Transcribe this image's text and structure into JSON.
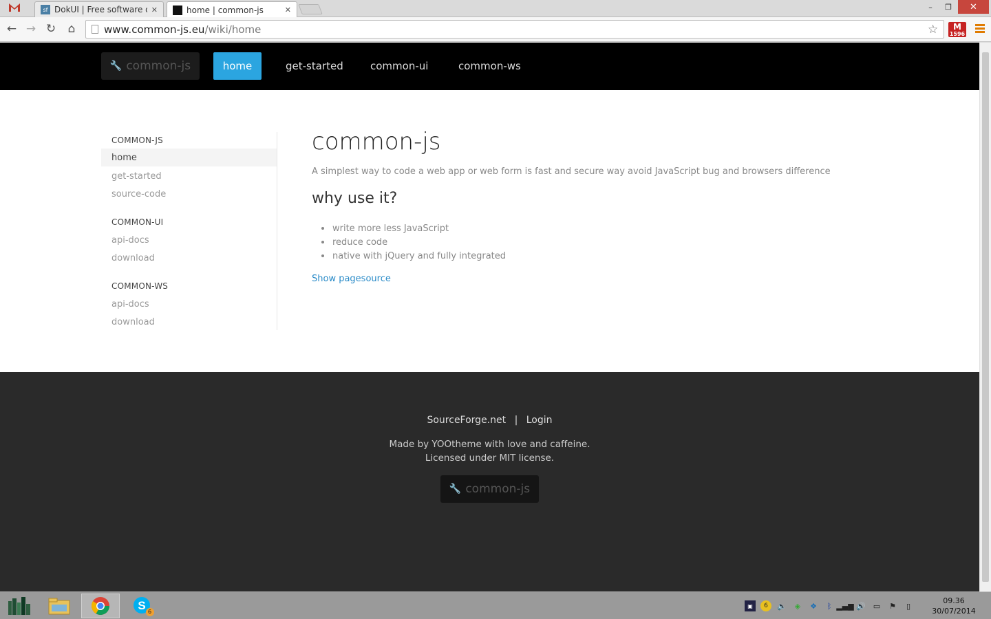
{
  "browser": {
    "tabs": [
      {
        "title": "DokUI | Free software dow",
        "active": false
      },
      {
        "title": "home | common-js",
        "active": true
      }
    ],
    "url_host": "www.common-js.eu",
    "url_path": "/wiki/home",
    "extension_badge_count": "1596",
    "extension_badge_letter": "M",
    "window_controls": {
      "minimize": "–",
      "restore": "❐",
      "close": "✕"
    }
  },
  "site_nav": {
    "brand": "common-js",
    "items": [
      {
        "label": "home",
        "active": true
      },
      {
        "label": "get-started",
        "active": false
      },
      {
        "label": "common-ui",
        "active": false
      },
      {
        "label": "common-ws",
        "active": false
      }
    ]
  },
  "sidebar": {
    "sections": [
      {
        "header": "COMMON-JS",
        "links": [
          {
            "label": "home",
            "active": true
          },
          {
            "label": "get-started",
            "active": false
          },
          {
            "label": "source-code",
            "active": false
          }
        ]
      },
      {
        "header": "COMMON-UI",
        "links": [
          {
            "label": "api-docs",
            "active": false
          },
          {
            "label": "download",
            "active": false
          }
        ]
      },
      {
        "header": "COMMON-WS",
        "links": [
          {
            "label": "api-docs",
            "active": false
          },
          {
            "label": "download",
            "active": false
          }
        ]
      }
    ]
  },
  "content": {
    "title": "common-js",
    "lead": "A simplest way to code a web app or web form is fast and secure way avoid JavaScript bug and browsers difference",
    "subtitle": "why use it?",
    "bullets": [
      "write more less JavaScript",
      "reduce code",
      "native with jQuery and fully integrated"
    ],
    "show_source": "Show pagesource"
  },
  "footer": {
    "link_sourceforge": "SourceForge.net",
    "separator": "|",
    "link_login": "Login",
    "made_by": "Made by YOOtheme with love and caffeine.",
    "license": "Licensed under MIT license.",
    "brand": "common-js"
  },
  "taskbar": {
    "clock_time": "09.36",
    "clock_date": "30/07/2014",
    "skype_badge": "6",
    "tray_badge": "6"
  },
  "colors": {
    "nav_active": "#2ba5e0",
    "link": "#2a8bc8",
    "footer_bg": "#2a2a2a",
    "nav_bg": "#000000"
  }
}
